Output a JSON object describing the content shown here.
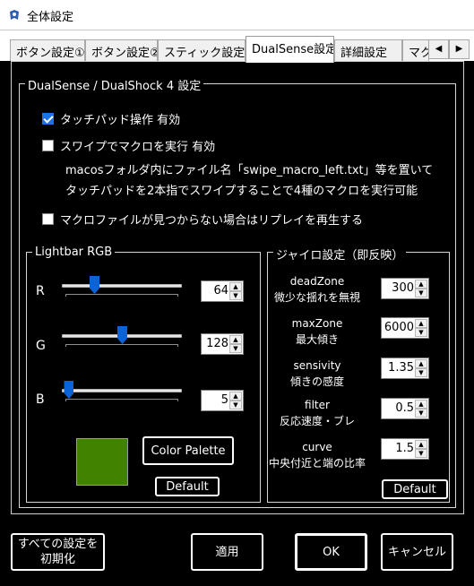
{
  "window": {
    "title": "全体設定",
    "icon": "gamepad-icon"
  },
  "tabs": [
    {
      "label": "ボタン設定①",
      "active": false
    },
    {
      "label": "ボタン設定②",
      "active": false
    },
    {
      "label": "スティック設定",
      "active": false
    },
    {
      "label": "DualSense設定",
      "active": true
    },
    {
      "label": "詳細設定",
      "active": false
    },
    {
      "label": "マク",
      "active": false
    }
  ],
  "tab_scroll": {
    "left": "◀",
    "right": "▶"
  },
  "dualsense": {
    "group_title": "DualSense / DualShock 4 設定",
    "touchpad": {
      "label": "タッチパッド操作 有効",
      "checked": true
    },
    "swipe": {
      "label": "スワイプでマクロを実行 有効",
      "checked": false,
      "note1": "macosフォルダ内にファイル名「swipe_macro_left.txt」等を置いて",
      "note2": "タッチパッドを2本指でスワイプすることで4種のマクロを実行可能"
    },
    "replay": {
      "label": "マクロファイルが見つからない場合はリプレイを再生する",
      "checked": false
    }
  },
  "lightbar": {
    "group_title": "Lightbar RGB",
    "channels": [
      {
        "label": "R",
        "value": "64",
        "fraction": 0.25
      },
      {
        "label": "G",
        "value": "128",
        "fraction": 0.5
      },
      {
        "label": "B",
        "value": "5",
        "fraction": 0.02
      }
    ],
    "swatch_color": "#3f8300",
    "color_palette_label": "Color Palette",
    "default_label": "Default"
  },
  "gyro": {
    "group_title": "ジャイロ設定（即反映）",
    "items": [
      {
        "name": "deadZone",
        "desc": "微少な揺れを無視",
        "value": "300"
      },
      {
        "name": "maxZone",
        "desc": "最大傾き",
        "value": "6000"
      },
      {
        "name": "sensivity",
        "desc": "傾きの感度",
        "value": "1.35"
      },
      {
        "name": "filter",
        "desc": "反応速度・ブレ",
        "value": "0.5"
      },
      {
        "name": "curve",
        "desc": "中央付近と端の比率",
        "value": "1.5"
      }
    ],
    "default_label": "Default"
  },
  "footer": {
    "reset_line1": "すべての設定を",
    "reset_line2": "初期化",
    "apply": "適用",
    "ok": "OK",
    "cancel": "キャンセル"
  },
  "spin_arrows": {
    "up": "▲",
    "down": "▼"
  }
}
